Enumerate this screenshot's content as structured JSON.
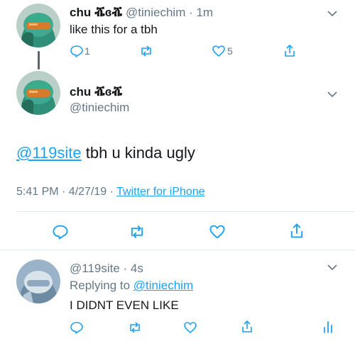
{
  "tweet1": {
    "display_name": "chu ⶤɞⶤ",
    "handle_time": "@tiniechim · 1m",
    "text": "like this for a tbh",
    "reply_count": "1",
    "like_count": "5"
  },
  "main": {
    "display_name": "chu ⶤɞⶤ",
    "handle": "@tiniechim",
    "mention": "@119site",
    "text": " tbh u kinda ugly",
    "time_date": "5:41 PM · 4/27/19 · ",
    "source": "Twitter for iPhone"
  },
  "reply": {
    "handle_time": "@119site · 4s",
    "replying_prefix": "Replying to ",
    "replying_handle": "@tiniechim",
    "text": "I DIDNT EVEN LIKE"
  },
  "colors": {
    "link": "#1da1f2",
    "secondary": "#657786",
    "divider": "#e1e8ed",
    "icon": "#1da1f2"
  },
  "icons": {
    "chevron": "chevron-down-icon",
    "reply": "reply-icon",
    "retweet": "retweet-icon",
    "like": "heart-icon",
    "share": "share-icon",
    "analytics": "analytics-icon"
  }
}
